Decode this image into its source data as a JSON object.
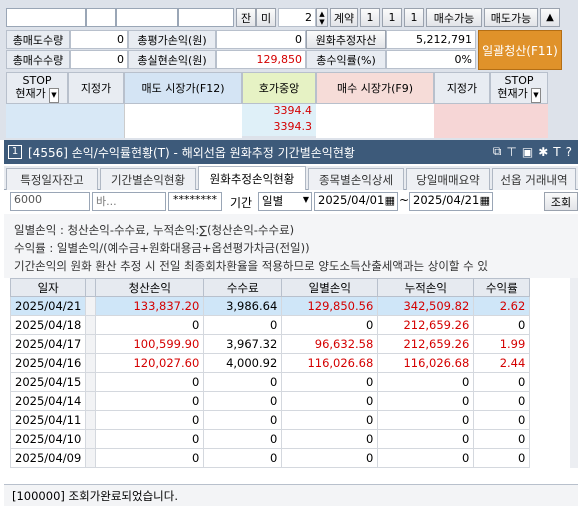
{
  "order_panel": {
    "jan": "잔",
    "mi": "미",
    "qty": "2",
    "contract_label": "계약",
    "one_a": "1",
    "one_b": "1",
    "one_c": "1",
    "sell_avail": "매수가능",
    "buy_avail": "매도가능",
    "sell_total_qty_label": "총매도수량",
    "sell_total_qty": "0",
    "total_eval_pl_label": "총평가손익(원)",
    "total_eval_pl": "0",
    "fx_asset_btn": "원화추정자산",
    "fx_asset_value": "5,212,791",
    "buy_total_qty_label": "총매수수량",
    "buy_total_qty": "0",
    "total_realized_label": "총실현손익(원)",
    "total_realized": "129,850",
    "total_return_label": "총수익률(%)",
    "total_return": "0%",
    "liquidate_all": "일괄청산(F11)",
    "stop_left": "STOP",
    "current_price_left": "현재가",
    "designated_left": "지정가",
    "sell_market": "매도 시장가(F12)",
    "hoga_center": "호가중앙",
    "buy_market": "매수 시장가(F9)",
    "designated_right": "지정가",
    "stop_right": "STOP",
    "current_price_right": "현재가",
    "price1": "3394.4",
    "price2": "3394.3"
  },
  "window": {
    "number": "1",
    "title": "[4556] 손익/수익률현황(T) - 해외선옵 원화추정 기간별손익현황"
  },
  "tabs": [
    "특정일자잔고",
    "기간별손익현황",
    "원화추정손익현황",
    "종목별손익상세",
    "당일매매요약",
    "선옵 거래내역"
  ],
  "active_tab": 2,
  "query": {
    "account": "6000",
    "account_name": "바... ",
    "password": "********",
    "period_label": "기간",
    "period_type": "일별",
    "date_from": "2025/04/01",
    "tilde": "~",
    "date_to": "2025/04/21",
    "search_btn": "조회"
  },
  "notes": {
    "line1": "일별손익 : 청산손익-수수료, 누적손익:∑(청산손익-수수료)",
    "line2": "수익률   : 일별손익/(예수금+원화대용금+옵션평가차금(전일))",
    "line3": "기간손익의 원화 환산 추정 시 전일 최종회차환율을 적용하므로 양도소득산출세액과는 상이할 수 있"
  },
  "table": {
    "headers": [
      "일자",
      "청산손익",
      "수수료",
      "일별손익",
      "누적손익",
      "수익률"
    ],
    "rows": [
      {
        "date": "2025/04/21",
        "liq": "133,837.20",
        "fee": "3,986.64",
        "daily": "129,850.56",
        "cum": "342,509.82",
        "ret": "2.62"
      },
      {
        "date": "2025/04/18",
        "liq": "0",
        "fee": "0",
        "daily": "0",
        "cum": "212,659.26",
        "ret": "0"
      },
      {
        "date": "2025/04/17",
        "liq": "100,599.90",
        "fee": "3,967.32",
        "daily": "96,632.58",
        "cum": "212,659.26",
        "ret": "1.99"
      },
      {
        "date": "2025/04/16",
        "liq": "120,027.60",
        "fee": "4,000.92",
        "daily": "116,026.68",
        "cum": "116,026.68",
        "ret": "2.44"
      },
      {
        "date": "2025/04/15",
        "liq": "0",
        "fee": "0",
        "daily": "0",
        "cum": "0",
        "ret": "0"
      },
      {
        "date": "2025/04/14",
        "liq": "0",
        "fee": "0",
        "daily": "0",
        "cum": "0",
        "ret": "0"
      },
      {
        "date": "2025/04/11",
        "liq": "0",
        "fee": "0",
        "daily": "0",
        "cum": "0",
        "ret": "0"
      },
      {
        "date": "2025/04/10",
        "liq": "0",
        "fee": "0",
        "daily": "0",
        "cum": "0",
        "ret": "0"
      },
      {
        "date": "2025/04/09",
        "liq": "0",
        "fee": "0",
        "daily": "0",
        "cum": "0",
        "ret": "0"
      }
    ]
  },
  "status": "[100000] 조회가완료되었습니다.",
  "colors": {
    "titlebar": "#3d5a7a",
    "accent_orange": "#e0922a",
    "red": "#d40000",
    "blue": "#1a3cc8"
  }
}
